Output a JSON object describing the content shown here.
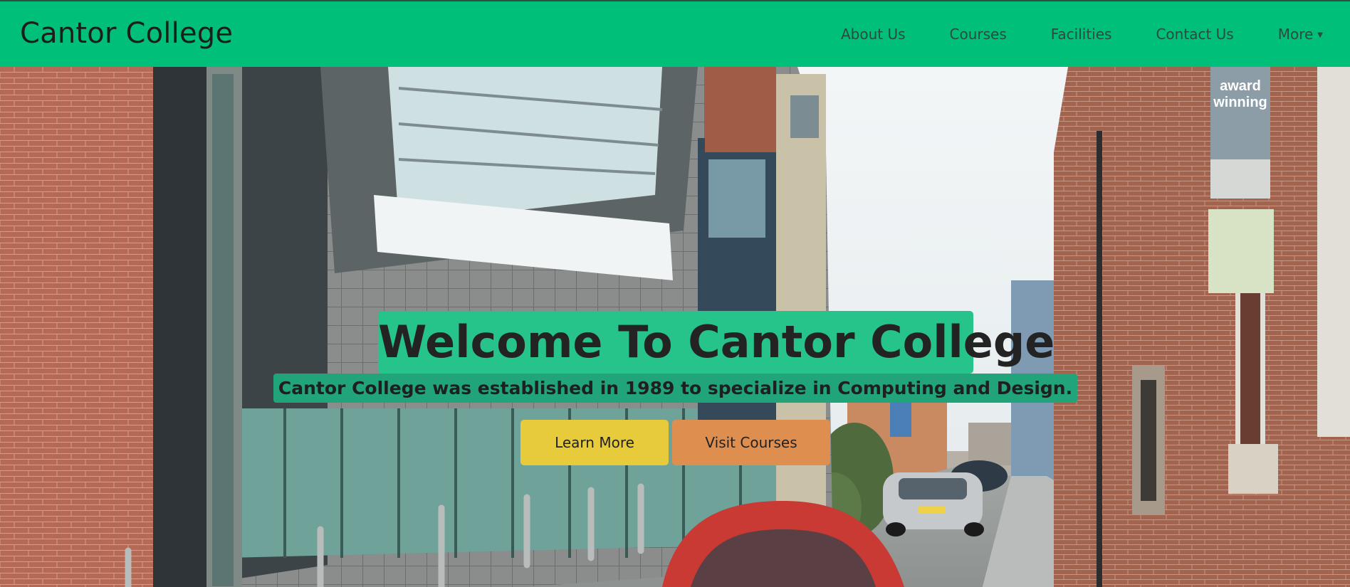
{
  "navbar": {
    "brand": "Cantor College",
    "links": [
      {
        "label": "About Us"
      },
      {
        "label": "Courses"
      },
      {
        "label": "Facilities"
      },
      {
        "label": "Contact Us"
      },
      {
        "label": "More"
      }
    ]
  },
  "hero": {
    "title": "Welcome To Cantor College",
    "subtitle": "Cantor College was established in 1989 to specialize in Computing and Design.",
    "buttons": {
      "learn_more": "Learn More",
      "visit_courses": "Visit Courses"
    },
    "banner_text": "award winning"
  },
  "colors": {
    "navbar": "#00bf78",
    "title_highlight": "#26c48a",
    "subtitle_highlight": "#21a47a",
    "learn_more_button": "#e7cb3a",
    "visit_courses_button": "#de8e4f"
  }
}
